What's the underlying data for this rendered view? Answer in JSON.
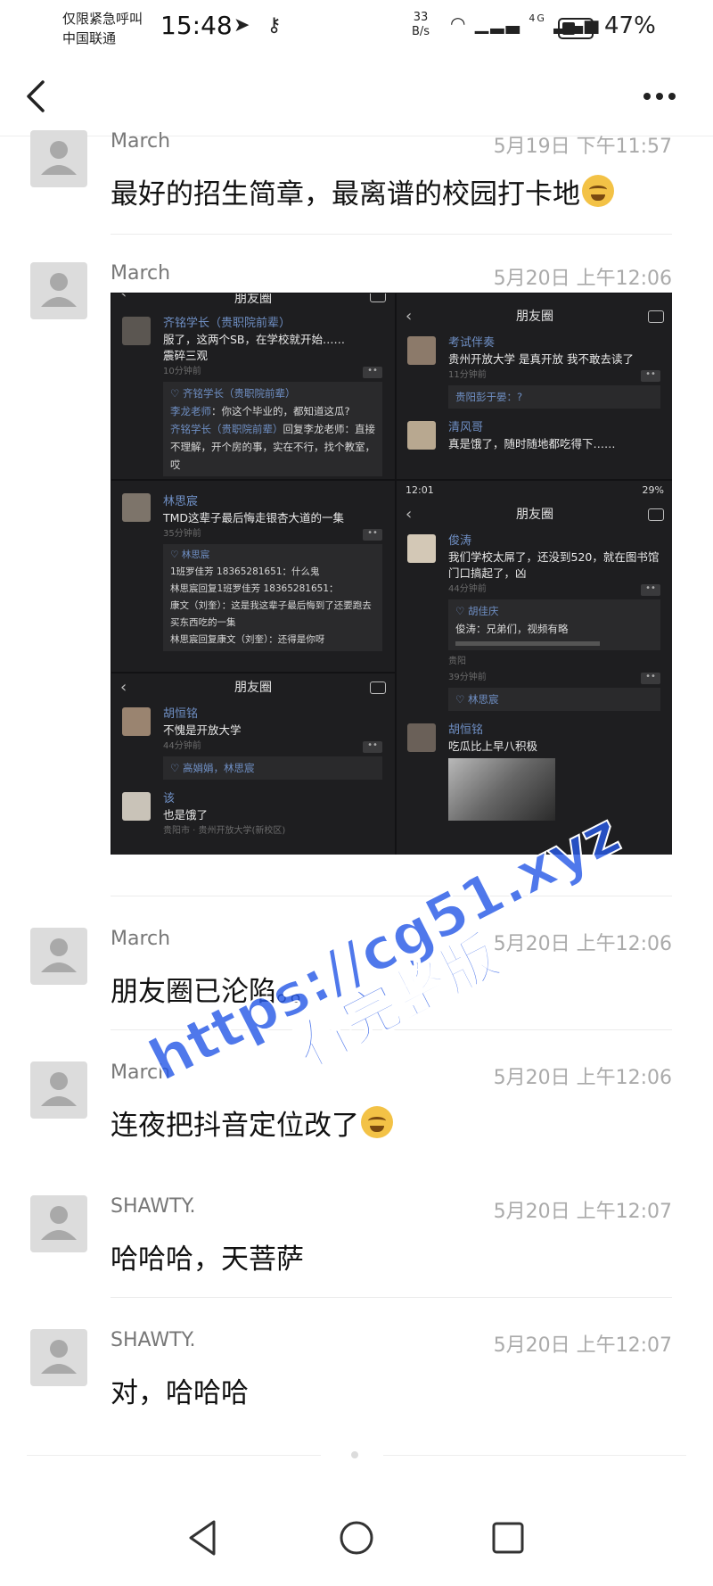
{
  "status_bar": {
    "carrier_line1": "仅限紧急呼叫",
    "carrier_line2": "中国联通",
    "time": "15:48",
    "rate_value": "33",
    "rate_unit": "B/s",
    "network": "4G",
    "battery_percent": "47%",
    "battery_level": 0.47
  },
  "nav": {
    "back_icon": "chevron-left-icon",
    "more_icon": "more-dots-icon"
  },
  "comments": [
    {
      "name": "March",
      "time": "5月19日 下午11:57",
      "text": "最好的招生简章，最离谱的校园打卡地",
      "emoji": "crying-laughing-emoji"
    },
    {
      "name": "March",
      "time": "5月20日 上午12:06",
      "text": ""
    },
    {
      "name": "March",
      "time": "5月20日 上午12:06",
      "text": "朋友圈已沦陷。。"
    },
    {
      "name": "March",
      "time": "5月20日 上午12:06",
      "text": "连夜把抖音定位改了",
      "emoji": "crying-laughing-emoji"
    },
    {
      "name": "SHAWTY.",
      "time": "5月20日 上午12:07",
      "text": "哈哈哈，天菩萨"
    },
    {
      "name": "SHAWTY.",
      "time": "5月20日 上午12:07",
      "text": "对，哈哈哈"
    }
  ],
  "collage": {
    "panel_title": "朋友圈",
    "status_time": "12:01",
    "status_battery": "29%",
    "panel_a": {
      "name": "齐铭学长（贵职院前辈）",
      "text1": "服了，这两个SB，在学校就开始……",
      "text2": "震碎三观",
      "meta": "10分钟前",
      "likes": "♡ 齐铭学长（贵职院前辈）",
      "c1_name": "李龙老师",
      "c1_text": "：你这个毕业的，都知道这瓜?",
      "c2_name": "齐铭学长（贵职院前辈）",
      "c2_text": "回复李龙老师：直接不理解，开个房的事，实在不行，找个教室，哎"
    },
    "panel_b": {
      "n1": "考试伴奏",
      "t1": "贵州开放大学 是真开放 我不敢去读了",
      "m1": "11分钟前",
      "c1": "贵阳彭于晏：?",
      "n2": "清风哥",
      "t2": "真是饿了，随时随地都吃得下……"
    },
    "panel_c": {
      "name": "林思宸",
      "text": "TMD这辈子最后悔走银杏大道的一集",
      "meta": "35分钟前",
      "likes": "♡ 林思宸",
      "c1": "1班罗佳芳 18365281651：什么鬼",
      "c2": "林思宸回复1班罗佳芳 18365281651：",
      "c3": "康文（刘奎）：这是我这辈子最后悔到了还要跑去买东西吃的一集",
      "c4": "林思宸回复康文（刘奎）：还得是你呀"
    },
    "panel_d": {
      "n1": "俊涛",
      "t1": "我们学校太屌了，还没到520，就在图书馆门口搞起了，凶",
      "m1": "44分钟前",
      "likes1": "♡ 胡佳庆",
      "c1": "俊涛：兄弟们，视频有略",
      "loc": "贵阳",
      "m2": "39分钟前",
      "likes2": "♡ 林思宸",
      "n2": "胡恒铭",
      "t2": "吃瓜比上早八积极"
    },
    "panel_e": {
      "n1": "胡恒铭",
      "t1": "不愧是开放大学",
      "m1": "44分钟前",
      "likes": "♡ 高娟娟，林思宸",
      "n2": "该",
      "t2": "也是饿了",
      "loc": "贵阳市 · 贵州开放大学(新校区)"
    }
  },
  "watermark": {
    "line1": "https://cg51.xyz",
    "line2": "看完整版"
  },
  "system_nav": {
    "back": "triangle-back-icon",
    "home": "circle-home-icon",
    "recents": "square-recents-icon"
  }
}
